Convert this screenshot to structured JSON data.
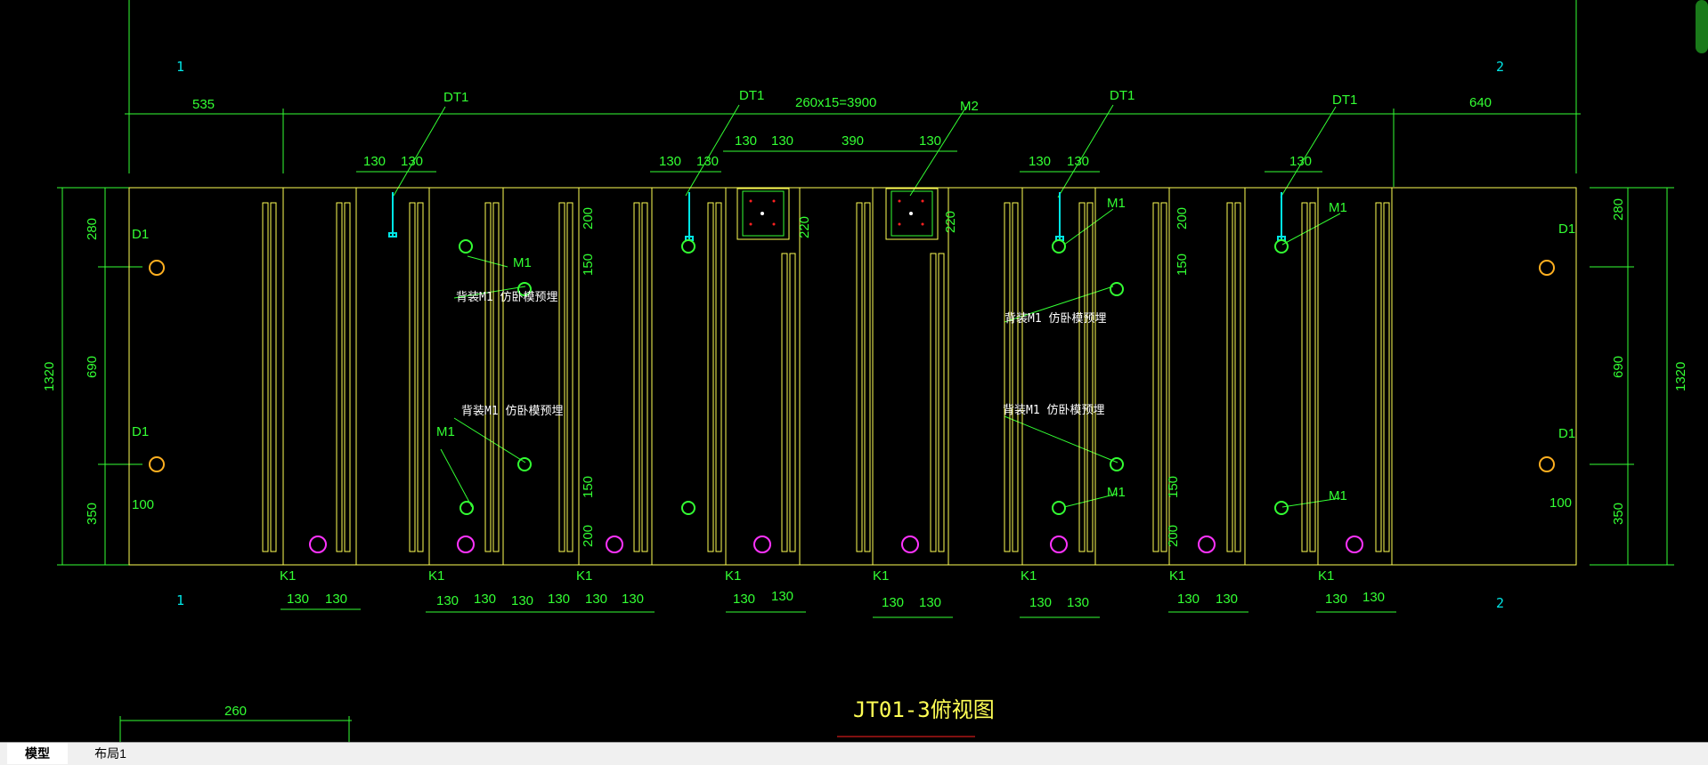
{
  "drawing": {
    "title": "JT01-3俯视图",
    "top_dims": [
      "535",
      "260x15=3900",
      "640"
    ],
    "section_marks": [
      "1",
      "2",
      "1",
      "2"
    ],
    "dt_labels": [
      "DT1",
      "DT1",
      "DT1",
      "DT1"
    ],
    "m2_label": "M2",
    "small_dims_130": "130",
    "dim_390": "390",
    "dim_220": "220",
    "dim_200": "200",
    "dim_150": "150",
    "left_dims": [
      "280",
      "690",
      "350",
      "1320"
    ],
    "right_dims": [
      "280",
      "690",
      "350",
      "1320"
    ],
    "d1_label": "D1",
    "m1_label": "M1",
    "k1_label": "K1",
    "dim_100": "100",
    "note_back": "背装M1 仿卧模预埋",
    "bottom_left_dim": "260"
  },
  "tabs": [
    {
      "label": "模型",
      "active": true
    },
    {
      "label": "布局1",
      "active": false
    }
  ],
  "colors": {
    "background": "#000000",
    "green": "#33ff33",
    "yellow": "#ffff55",
    "cyan": "#00e5e5",
    "magenta": "#ff33ff",
    "red": "#ff2020"
  }
}
